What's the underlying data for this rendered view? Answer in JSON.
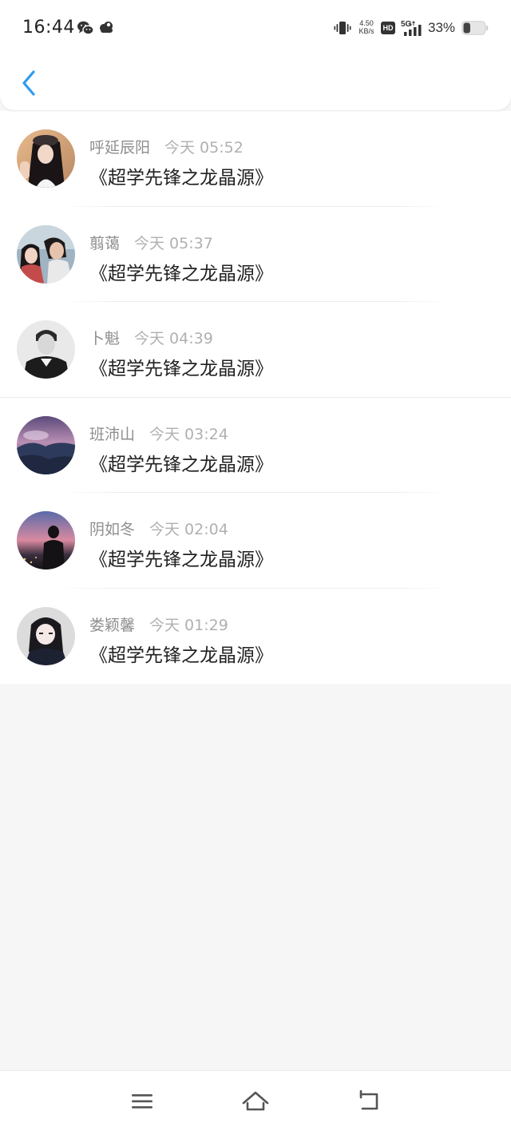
{
  "status_bar": {
    "time": "16:44",
    "net_speed_value": "4.50",
    "net_speed_unit": "KB/s",
    "hd_label": "HD",
    "network_label": "5G",
    "battery_percent": "33%",
    "battery_level": 0.33,
    "icons": [
      "wechat-icon",
      "cloud-icon",
      "vibrate-icon",
      "signal-icon",
      "battery-icon"
    ]
  },
  "nav": {
    "back_icon": "chevron-left-icon",
    "accent_color": "#2d9bf0"
  },
  "messages": [
    {
      "author": "呼延辰阳",
      "time": "今天 05:52",
      "title": "《超学先锋之龙晶源》"
    },
    {
      "author": "翦蔼",
      "time": "今天 05:37",
      "title": "《超学先锋之龙晶源》"
    },
    {
      "author": "卜魁",
      "time": "今天 04:39",
      "title": "《超学先锋之龙晶源》"
    },
    {
      "author": "班沛山",
      "time": "今天 03:24",
      "title": "《超学先锋之龙晶源》"
    },
    {
      "author": "阴如冬",
      "time": "今天 02:04",
      "title": "《超学先锋之龙晶源》"
    },
    {
      "author": "娄颖馨",
      "time": "今天 01:29",
      "title": "《超学先锋之龙晶源》"
    }
  ],
  "bottom_nav": {
    "icons": [
      "menu-icon",
      "home-icon",
      "back-icon"
    ]
  }
}
